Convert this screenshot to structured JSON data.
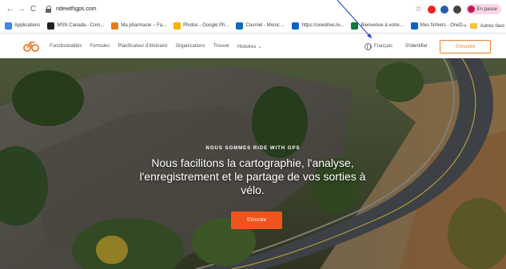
{
  "browser": {
    "url": "ridewithgps.com",
    "nav_icons": {
      "back": "←",
      "forward": "→",
      "reload": "C"
    },
    "profile_status": "En pause",
    "bookmarks": [
      {
        "label": "Applications",
        "color": "#4285f4"
      },
      {
        "label": "MSN Canada - Com...",
        "color": "#222222"
      },
      {
        "label": "Ma pharmacie – Fa...",
        "color": "#e67c1f"
      },
      {
        "label": "Photos - Google Ph...",
        "color": "#f4b400"
      },
      {
        "label": "Courriel - Monic ...",
        "color": "#0f6cbd"
      },
      {
        "label": "https://onedrive.liv...",
        "color": "#0a64c8"
      },
      {
        "label": "Bienvenue à votre...",
        "color": "#0b7a3e"
      },
      {
        "label": "Mes fichiers - OneD...",
        "color": "#0a64c8"
      }
    ],
    "bookmarks_more": "»",
    "other_bookmarks": "Autres favo"
  },
  "site": {
    "nav": [
      "Fonctionnalités",
      "Formules",
      "Planificateur d'itinéraire",
      "Organisations",
      "Trouver",
      "Histoires"
    ],
    "nav_caret": "⌄",
    "language": "Français",
    "signin": "S'identifier",
    "signup": "S'inscrire",
    "accent_color": "#f0541e"
  },
  "hero": {
    "eyebrow": "NOUS SOMMES RIDE WITH GPS",
    "headline": "Nous facilitons la cartographie, l'analyse, l'enregistrement et le partage de vos sorties à vélo.",
    "cta": "S'inscrire"
  }
}
